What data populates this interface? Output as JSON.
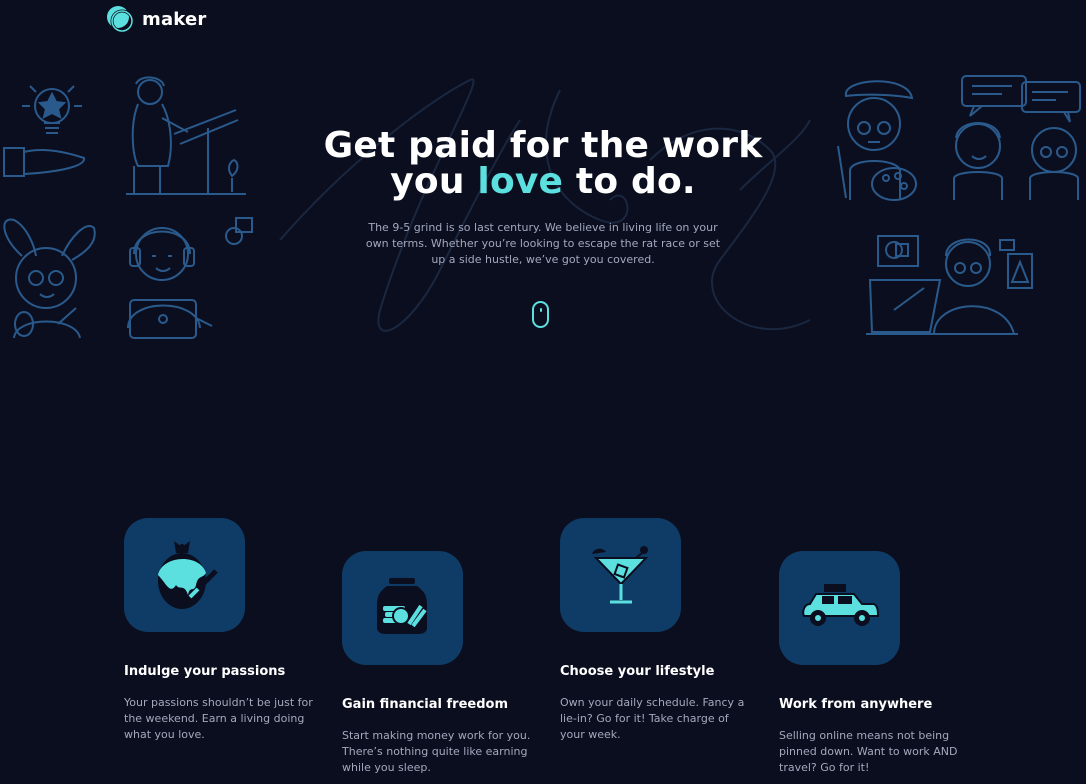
{
  "brand": {
    "name": "maker",
    "accent": "#5ce0df"
  },
  "hero": {
    "title_line1": "Get paid for the work",
    "title_prefix": "you ",
    "title_accent": "love",
    "title_suffix": " to do.",
    "description": "The 9-5 grind is so last century. We believe in living life on your own terms. Whether you’re looking to escape the rat race or set up a side hustle, we’ve got you covered."
  },
  "features": [
    {
      "icon": "painted-egg-icon",
      "title": "Indulge your passions",
      "text": "Your passions shouldn’t be just for the weekend. Earn a living doing what you love."
    },
    {
      "icon": "money-jar-icon",
      "title": "Gain financial freedom",
      "text": "Start making money work for you. There’s nothing quite like earning while you sleep."
    },
    {
      "icon": "cocktail-icon",
      "title": "Choose your lifestyle",
      "text": "Own your daily schedule. Fancy a lie-in? Go for it! Take charge of your week."
    },
    {
      "icon": "car-icon",
      "title": "Work from anywhere",
      "text": "Selling online means not being pinned down. Want to work AND travel? Go for it!"
    }
  ]
}
